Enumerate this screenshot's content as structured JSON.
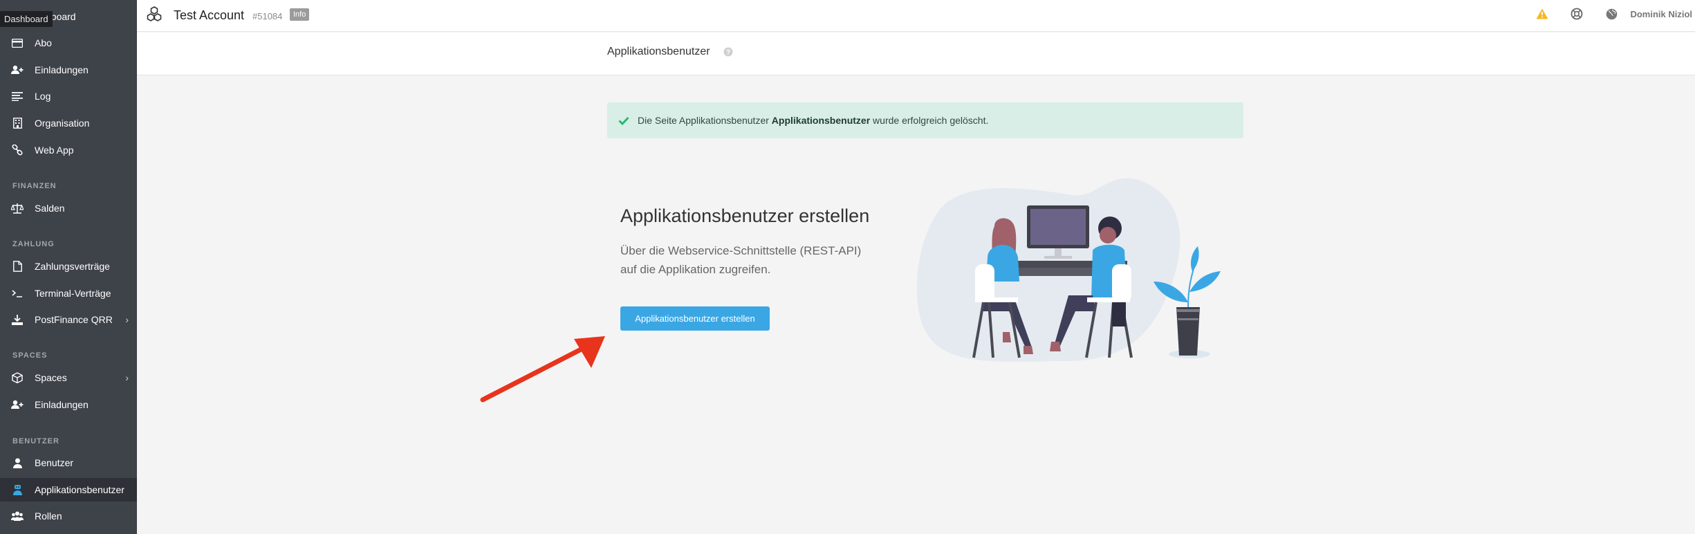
{
  "sidebar": {
    "tooltip": "Dashboard",
    "dashboard_partial": "hboard",
    "items_top": [
      {
        "label": "Abo",
        "icon": "credit-card-icon"
      },
      {
        "label": "Einladungen",
        "icon": "user-plus-icon"
      },
      {
        "label": "Log",
        "icon": "list-icon"
      },
      {
        "label": "Organisation",
        "icon": "building-icon"
      },
      {
        "label": "Web App",
        "icon": "link-icon"
      }
    ],
    "sections": {
      "finanzen": "FINANZEN",
      "zahlung": "ZAHLUNG",
      "spaces": "SPACES",
      "benutzer": "BENUTZER"
    },
    "items_finanzen": [
      {
        "label": "Salden",
        "icon": "balance-scale-icon"
      }
    ],
    "items_zahlung": [
      {
        "label": "Zahlungsverträge",
        "icon": "file-icon"
      },
      {
        "label": "Terminal-Verträge",
        "icon": "terminal-icon"
      },
      {
        "label": "PostFinance QRR",
        "icon": "download-icon",
        "chevron": "›"
      }
    ],
    "items_spaces": [
      {
        "label": "Spaces",
        "icon": "cube-icon",
        "chevron": "›"
      },
      {
        "label": "Einladungen",
        "icon": "user-plus-icon"
      }
    ],
    "items_benutzer": [
      {
        "label": "Benutzer",
        "icon": "user-icon"
      },
      {
        "label": "Applikationsbenutzer",
        "icon": "robot-user-icon",
        "active": true
      },
      {
        "label": "Rollen",
        "icon": "users-icon"
      }
    ]
  },
  "topbar": {
    "account_name": "Test Account",
    "account_id": "#51084",
    "info_badge": "Info",
    "user_name": "Dominik Niziol",
    "icons": [
      "warning-icon",
      "lifebuoy-icon",
      "globe-icon"
    ]
  },
  "subheader": {
    "title": "Applikationsbenutzer"
  },
  "alert": {
    "prefix": "Die Seite Applikationsbenutzer ",
    "bold": "Applikationsbenutzer",
    "suffix": " wurde erfolgreich gelöscht."
  },
  "empty_state": {
    "title": "Applikationsbenutzer erstellen",
    "description": "Über die Webservice-Schnittstelle (REST-API) auf die Applikation zugreifen.",
    "button": "Applikationsbenutzer erstellen"
  },
  "colors": {
    "sidebar_bg": "#3e4249",
    "accent": "#3aa7e4",
    "alert_bg": "#d9eee6",
    "success": "#2bb673",
    "arrow": "#e8341c"
  }
}
